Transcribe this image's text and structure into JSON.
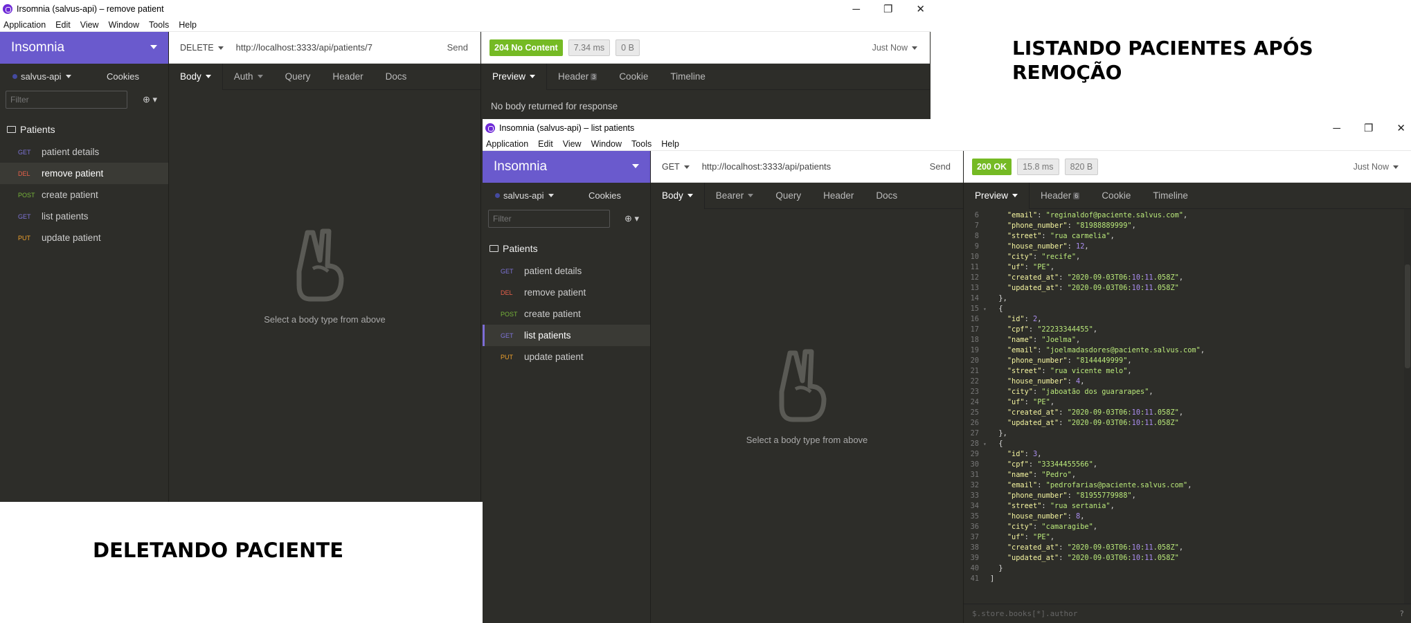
{
  "caption_top": "LISTANDO PACIENTES APÓS REMOÇÃO",
  "caption_bottom": "DELETANDO PACIENTE",
  "menu": [
    "Application",
    "Edit",
    "View",
    "Window",
    "Tools",
    "Help"
  ],
  "win_controls": {
    "minimize": "─",
    "maximize": "❐",
    "close": "✕"
  },
  "win1": {
    "title": "Irsomnia (salvus-api) – remove patient",
    "workspace": "Insomnia",
    "env": "salvus-api",
    "cookies": "Cookies",
    "filter_placeholder": "Filter",
    "folder": "Patients",
    "requests": [
      {
        "method": "GET",
        "name": "patient details"
      },
      {
        "method": "DEL",
        "name": "remove patient"
      },
      {
        "method": "POST",
        "name": "create patient"
      },
      {
        "method": "GET",
        "name": "list patients"
      },
      {
        "method": "PUT",
        "name": "update patient"
      }
    ],
    "method": "DELETE",
    "url": "http://localhost:3333/api/patients/7",
    "send": "Send",
    "req_tabs": [
      "Body",
      "Auth",
      "Query",
      "Header",
      "Docs"
    ],
    "empty_msg": "Select a body type from above",
    "status": "204 No Content",
    "time": "7.34 ms",
    "size": "0 B",
    "when": "Just Now",
    "resp_tabs": {
      "preview": "Preview",
      "header": "Header",
      "header_count": "3",
      "cookie": "Cookie",
      "timeline": "Timeline"
    },
    "no_body": "No body returned for response"
  },
  "win2": {
    "title": "Insomnia (salvus-api) – list patients",
    "workspace": "Insomnia",
    "env": "salvus-api",
    "cookies": "Cookies",
    "filter_placeholder": "Filter",
    "folder": "Patients",
    "requests": [
      {
        "method": "GET",
        "name": "patient details"
      },
      {
        "method": "DEL",
        "name": "remove patient"
      },
      {
        "method": "POST",
        "name": "create patient"
      },
      {
        "method": "GET",
        "name": "list patients"
      },
      {
        "method": "PUT",
        "name": "update patient"
      }
    ],
    "method": "GET",
    "url": "http://localhost:3333/api/patients",
    "send": "Send",
    "req_tabs": [
      "Body",
      "Bearer",
      "Query",
      "Header",
      "Docs"
    ],
    "empty_msg": "Select a body type from above",
    "status": "200 OK",
    "time": "15.8 ms",
    "size": "820 B",
    "when": "Just Now",
    "resp_tabs": {
      "preview": "Preview",
      "header": "Header",
      "header_count": "6",
      "cookie": "Cookie",
      "timeline": "Timeline"
    },
    "json_query_placeholder": "$.store.books[*].author",
    "help": "?",
    "code_lines": [
      {
        "n": "6",
        "t": "    \"email\": \"reginaldof@paciente.salvus.com\","
      },
      {
        "n": "7",
        "t": "    \"phone_number\": \"81988889999\","
      },
      {
        "n": "8",
        "t": "    \"street\": \"rua carmelia\","
      },
      {
        "n": "9",
        "t": "    \"house_number\": 12,"
      },
      {
        "n": "10",
        "t": "    \"city\": \"recife\","
      },
      {
        "n": "11",
        "t": "    \"uf\": \"PE\","
      },
      {
        "n": "12",
        "t": "    \"created_at\": \"2020-09-03T06:10:11.058Z\","
      },
      {
        "n": "13",
        "t": "    \"updated_at\": \"2020-09-03T06:10:11.058Z\""
      },
      {
        "n": "14",
        "t": "  },"
      },
      {
        "n": "15",
        "t": "  {",
        "f": "▾"
      },
      {
        "n": "16",
        "t": "    \"id\": 2,"
      },
      {
        "n": "17",
        "t": "    \"cpf\": \"22233344455\","
      },
      {
        "n": "18",
        "t": "    \"name\": \"Joelma\","
      },
      {
        "n": "19",
        "t": "    \"email\": \"joelmadasdores@paciente.salvus.com\","
      },
      {
        "n": "20",
        "t": "    \"phone_number\": \"8144449999\","
      },
      {
        "n": "21",
        "t": "    \"street\": \"rua vicente melo\","
      },
      {
        "n": "22",
        "t": "    \"house_number\": 4,"
      },
      {
        "n": "23",
        "t": "    \"city\": \"jaboatão dos guararapes\","
      },
      {
        "n": "24",
        "t": "    \"uf\": \"PE\","
      },
      {
        "n": "25",
        "t": "    \"created_at\": \"2020-09-03T06:10:11.058Z\","
      },
      {
        "n": "26",
        "t": "    \"updated_at\": \"2020-09-03T06:10:11.058Z\""
      },
      {
        "n": "27",
        "t": "  },"
      },
      {
        "n": "28",
        "t": "  {",
        "f": "▾"
      },
      {
        "n": "29",
        "t": "    \"id\": 3,"
      },
      {
        "n": "30",
        "t": "    \"cpf\": \"33344455566\","
      },
      {
        "n": "31",
        "t": "    \"name\": \"Pedro\","
      },
      {
        "n": "32",
        "t": "    \"email\": \"pedrofarias@paciente.salvus.com\","
      },
      {
        "n": "33",
        "t": "    \"phone_number\": \"81955779988\","
      },
      {
        "n": "34",
        "t": "    \"street\": \"rua sertania\","
      },
      {
        "n": "35",
        "t": "    \"house_number\": 8,"
      },
      {
        "n": "36",
        "t": "    \"city\": \"camaragibe\","
      },
      {
        "n": "37",
        "t": "    \"uf\": \"PE\","
      },
      {
        "n": "38",
        "t": "    \"created_at\": \"2020-09-03T06:10:11.058Z\","
      },
      {
        "n": "39",
        "t": "    \"updated_at\": \"2020-09-03T06:10:11.058Z\""
      },
      {
        "n": "40",
        "t": "  }"
      },
      {
        "n": "41",
        "t": "]"
      }
    ]
  }
}
